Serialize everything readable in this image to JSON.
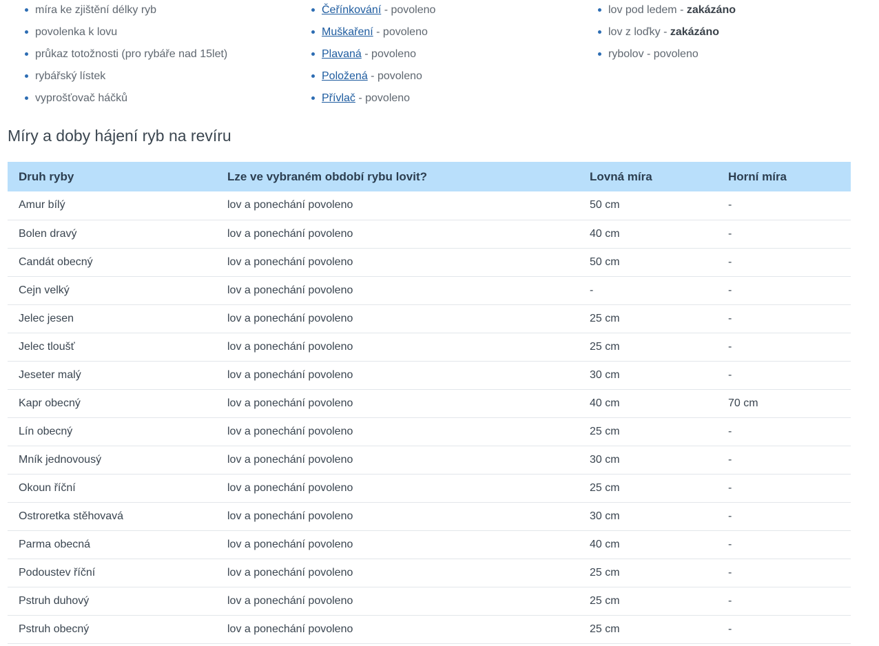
{
  "equipment": [
    "míra ke zjištění délky ryb",
    "povolenka k lovu",
    "průkaz totožnosti (pro rybáře nad 15let)",
    "rybářský lístek",
    "vyprošťovač háčků"
  ],
  "methods": [
    {
      "label": "Čeřínkování",
      "status": "povoleno"
    },
    {
      "label": "Muškaření",
      "status": "povoleno"
    },
    {
      "label": "Plavaná",
      "status": "povoleno"
    },
    {
      "label": "Položená",
      "status": "povoleno"
    },
    {
      "label": "Přívlač",
      "status": "povoleno"
    }
  ],
  "rules": [
    {
      "label": "lov pod ledem",
      "status": "zakázáno",
      "bold": true
    },
    {
      "label": "lov z loďky",
      "status": "zakázáno",
      "bold": true
    },
    {
      "label": "rybolov",
      "status": "povoleno",
      "bold": false
    }
  ],
  "separator": " - ",
  "section_title": "Míry a doby hájení ryb na revíru",
  "table": {
    "headers": [
      "Druh ryby",
      "Lze ve vybraném období rybu lovit?",
      "Lovná míra",
      "Horní míra"
    ],
    "rows": [
      [
        "Amur bílý",
        "lov a ponechání povoleno",
        "50 cm",
        "-"
      ],
      [
        "Bolen dravý",
        "lov a ponechání povoleno",
        "40 cm",
        "-"
      ],
      [
        "Candát obecný",
        "lov a ponechání povoleno",
        "50 cm",
        "-"
      ],
      [
        "Cejn velký",
        "lov a ponechání povoleno",
        "-",
        "-"
      ],
      [
        "Jelec jesen",
        "lov a ponechání povoleno",
        "25 cm",
        "-"
      ],
      [
        "Jelec tloušť",
        "lov a ponechání povoleno",
        "25 cm",
        "-"
      ],
      [
        "Jeseter malý",
        "lov a ponechání povoleno",
        "30 cm",
        "-"
      ],
      [
        "Kapr obecný",
        "lov a ponechání povoleno",
        "40 cm",
        "70 cm"
      ],
      [
        "Lín obecný",
        "lov a ponechání povoleno",
        "25 cm",
        "-"
      ],
      [
        "Mník jednovousý",
        "lov a ponechání povoleno",
        "30 cm",
        "-"
      ],
      [
        "Okoun říční",
        "lov a ponechání povoleno",
        "25 cm",
        "-"
      ],
      [
        "Ostroretka stěhovavá",
        "lov a ponechání povoleno",
        "30 cm",
        "-"
      ],
      [
        "Parma obecná",
        "lov a ponechání povoleno",
        "40 cm",
        "-"
      ],
      [
        "Podoustev říční",
        "lov a ponechání povoleno",
        "25 cm",
        "-"
      ],
      [
        "Pstruh duhový",
        "lov a ponechání povoleno",
        "25 cm",
        "-"
      ],
      [
        "Pstruh obecný",
        "lov a ponechání povoleno",
        "25 cm",
        "-"
      ]
    ]
  },
  "colors": {
    "link": "#1d5b9f",
    "bullet": "#2d6db3",
    "header_bg": "#b9dffb",
    "row_border": "#e2e6ea"
  }
}
